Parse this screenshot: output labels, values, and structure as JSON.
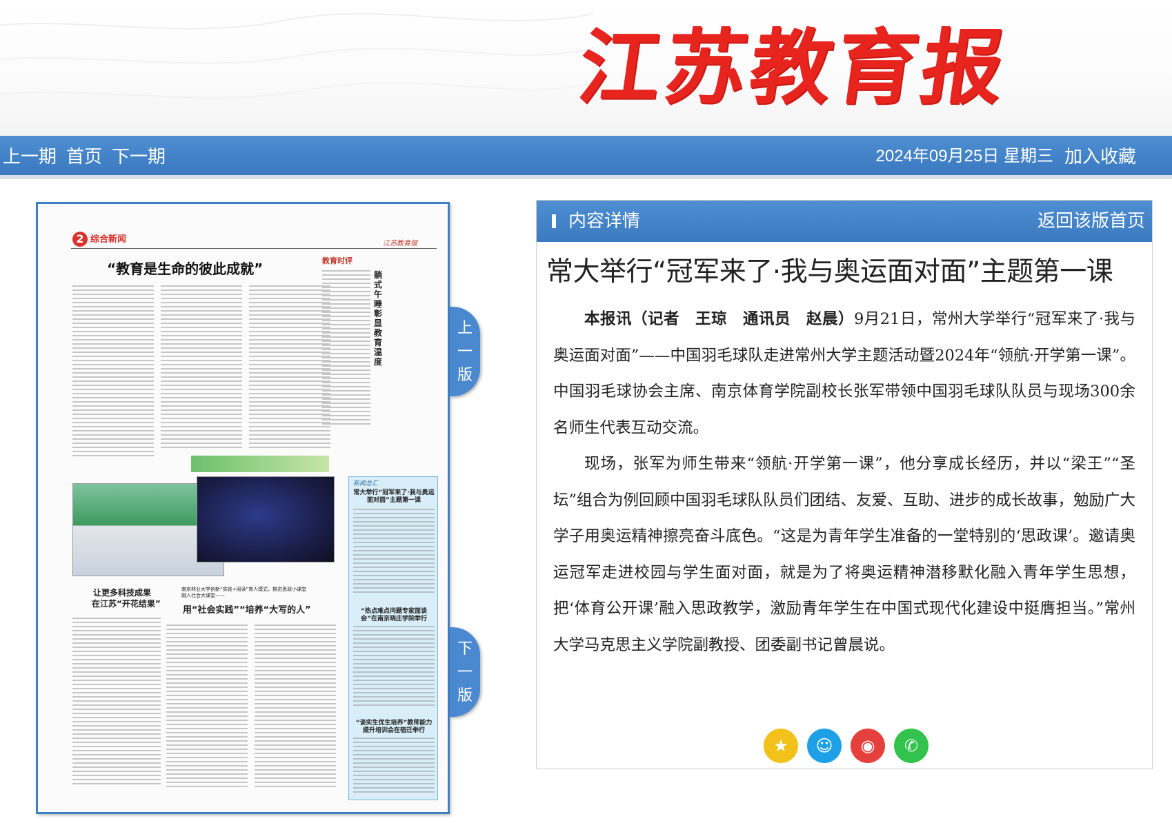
{
  "masthead": {
    "title": "江苏教育报"
  },
  "nav": {
    "prev_issue": "上一期",
    "home": "首页",
    "next_issue": "下一期",
    "date": "2024年09月25日 星期三",
    "bookmark": "加入收藏"
  },
  "paper": {
    "page_label": "综合新闻",
    "page_number": "2",
    "brand": "江苏教育报",
    "main_title": "“教育是生命的彼此成就”",
    "side_headline": "躺式午睡彰显教育温度",
    "bottom_left_title_1": "让更多科技成果",
    "bottom_left_title_2": "在江苏“开花结果”",
    "bottom_mid_kicker": "南京林业大学创新“实践+阅读”育人模式，推进思政小课堂融入社会大课堂——",
    "bottom_mid_title": "用“社会实践”“培养“大写的人”",
    "sidebar_tag": "新闻总汇",
    "sidebar_title": "常大举行“冠军来了·我与奥运面对面”主题第一课",
    "sidebar_sub1": "“热点难点问题专家面谈会”在南京晓庄学院举行",
    "sidebar_sub2": "“谈实生优生培养”教师能力提升培训会在宿迁举行",
    "column_tag": "教育时评"
  },
  "flip": {
    "up": [
      "上",
      "一",
      "版"
    ],
    "down": [
      "下",
      "一",
      "版"
    ]
  },
  "detail": {
    "section_title": "内容详情",
    "back_link": "返回该版首页",
    "headline": "常大举行“冠军来了·我与奥运面对面”主题第一课",
    "reporter": "本报讯（记者　王琼　通讯员　赵晨）",
    "para1": "9月21日，常州大学举行“冠军来了·我与奥运面对面”——中国羽毛球队走进常州大学主题活动暨2024年“领航·开学第一课”。中国羽毛球协会主席、南京体育学院副校长张军带领中国羽毛球队队员与现场300余名师生代表互动交流。",
    "para2": "现场，张军为师生带来“领航·开学第一课”，他分享成长经历，并以“梁王”“圣坛”组合为例回顾中国羽毛球队队员们团结、友爱、互助、进步的成长故事，勉励广大学子用奥运精神擦亮奋斗底色。“这是为青年学生准备的一堂特别的‘思政课’。邀请奥运冠军走进校园与学生面对面，就是为了将奥运精神潜移默化融入青年学生思想，把‘体育公开课’融入思政教学，激励青年学生在中国式现代化建设中挺膺担当。”常州大学马克思主义学院副教授、团委副书记曾晨说。"
  },
  "share": {
    "icons": [
      "qzone-icon",
      "qq-icon",
      "weibo-icon",
      "wechat-icon"
    ],
    "colors": [
      "#f2c21b",
      "#1ea0e6",
      "#e6403c",
      "#33c24d"
    ]
  }
}
